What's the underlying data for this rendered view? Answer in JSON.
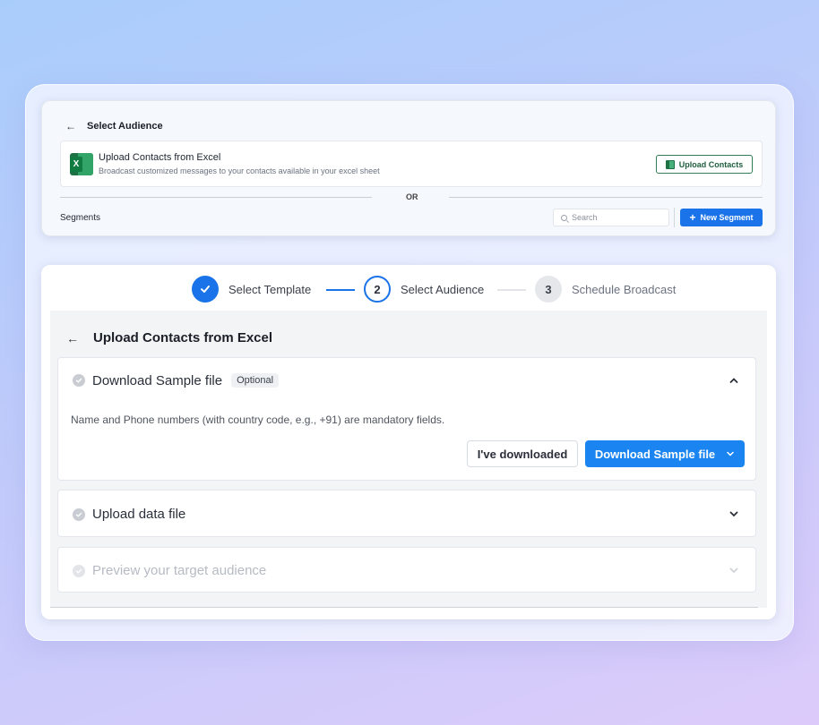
{
  "select_audience": {
    "title": "Select Audience",
    "excel": {
      "title": "Upload Contacts from Excel",
      "subtitle": "Broadcast customized messages to your contacts available in your excel sheet",
      "button_label": "Upload Contacts"
    },
    "divider_text": "OR",
    "segments_label": "Segments",
    "search_placeholder": "Search",
    "new_segment_label": "New Segment"
  },
  "stepper": [
    {
      "number": "1",
      "label": "Select Template",
      "state": "done"
    },
    {
      "number": "2",
      "label": "Select Audience",
      "state": "active"
    },
    {
      "number": "3",
      "label": "Schedule Broadcast",
      "state": "pending"
    }
  ],
  "upload_panel": {
    "title": "Upload Contacts from Excel",
    "sections": [
      {
        "title": "Download Sample file",
        "badge": "Optional",
        "expanded": true,
        "description": "Name and Phone numbers (with country code, e.g., +91) are mandatory fields.",
        "secondary_button": "I've downloaded",
        "primary_button": "Download Sample file"
      },
      {
        "title": "Upload data file",
        "expanded": false
      },
      {
        "title": "Preview your target audience",
        "expanded": false,
        "disabled": true
      }
    ]
  },
  "colors": {
    "primary": "#1a73e8",
    "excel_green": "#1e7145",
    "muted_check": "#c9ccd3"
  }
}
